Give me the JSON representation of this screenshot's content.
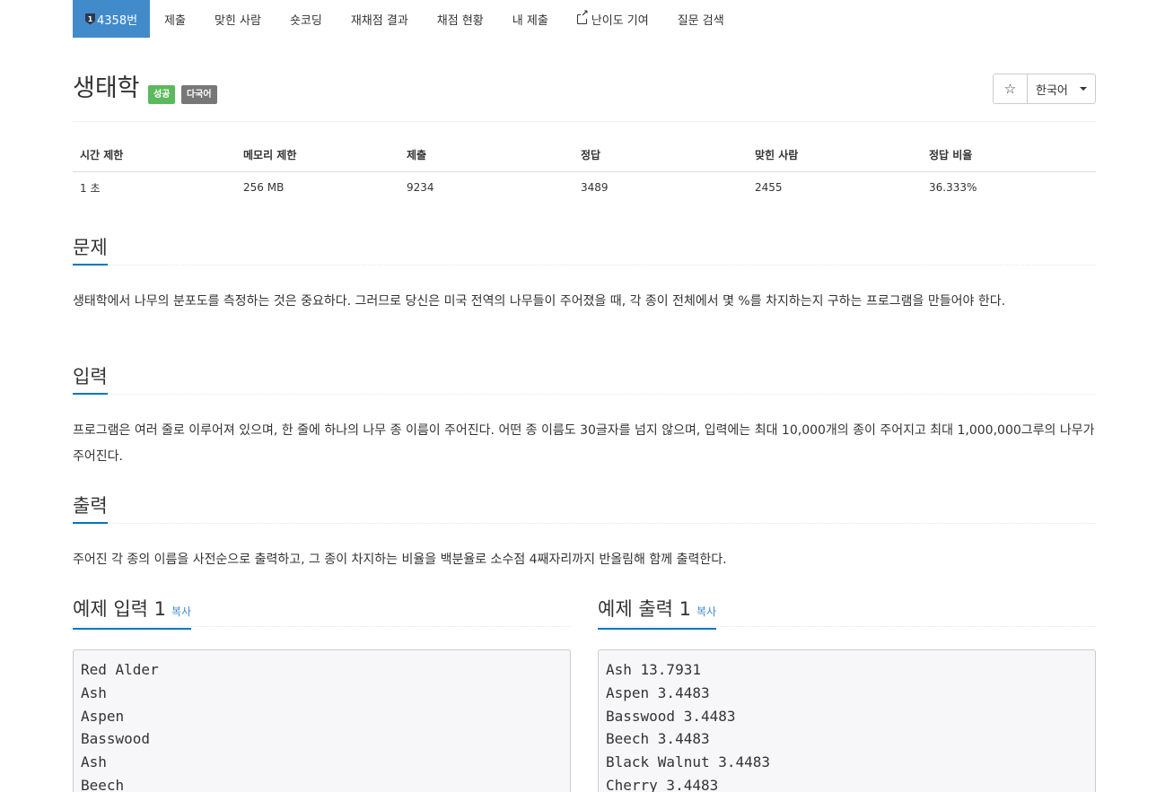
{
  "nav": {
    "problem_tier": "1",
    "problem_number": "4358번",
    "items": [
      "제출",
      "맞힌 사람",
      "숏코딩",
      "재채점 결과",
      "채점 현황",
      "내 제출",
      "난이도 기여",
      "질문 검색"
    ]
  },
  "problem": {
    "title": "생태학",
    "badge_success": "성공",
    "badge_multi": "다국어",
    "star_glyph": "☆",
    "language": "한국어"
  },
  "info_table": {
    "headers": [
      "시간 제한",
      "메모리 제한",
      "제출",
      "정답",
      "맞힌 사람",
      "정답 비율"
    ],
    "values": [
      "1 초",
      "256 MB",
      "9234",
      "3489",
      "2455",
      "36.333%"
    ]
  },
  "sections": {
    "description": {
      "heading": "문제",
      "text": "생태학에서 나무의 분포도를 측정하는 것은 중요하다. 그러므로 당신은 미국 전역의 나무들이 주어졌을 때, 각 종이 전체에서 몇 %를 차지하는지 구하는 프로그램을 만들어야 한다."
    },
    "input": {
      "heading": "입력",
      "text": "프로그램은 여러 줄로 이루어져 있으며, 한 줄에 하나의 나무 종 이름이 주어진다. 어떤 종 이름도 30글자를 넘지 않으며, 입력에는 최대 10,000개의 종이 주어지고 최대 1,000,000그루의 나무가 주어진다."
    },
    "output": {
      "heading": "출력",
      "text": "주어진 각 종의 이름을 사전순으로 출력하고, 그 종이 차지하는 비율을 백분율로 소수점 4째자리까지 반올림해 함께 출력한다."
    }
  },
  "samples": {
    "input": {
      "heading": "예제 입력 1",
      "copy": "복사",
      "lines": [
        "Red Alder",
        "Ash",
        "Aspen",
        "Basswood",
        "Ash",
        "Beech"
      ]
    },
    "output": {
      "heading": "예제 출력 1",
      "copy": "복사",
      "lines": [
        "Ash 13.7931",
        "Aspen 3.4483",
        "Basswood 3.4483",
        "Beech 3.4483",
        "Black Walnut 3.4483",
        "Cherry 3.4483"
      ]
    }
  },
  "colors": {
    "nav_active": "#428bca",
    "success": "#5cb85c",
    "multilang": "#777777",
    "heading_underline": "#0076c0",
    "link": "#428bca"
  }
}
